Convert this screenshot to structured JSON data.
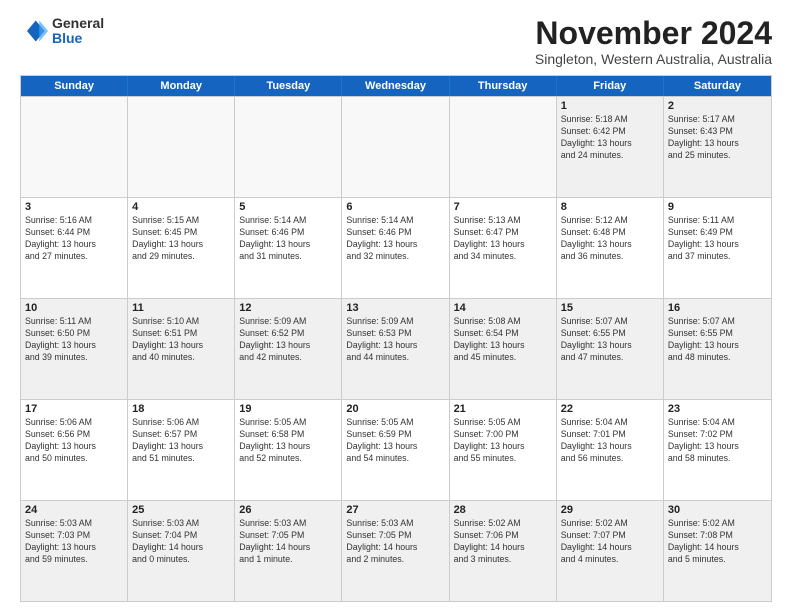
{
  "logo": {
    "general": "General",
    "blue": "Blue"
  },
  "title": "November 2024",
  "subtitle": "Singleton, Western Australia, Australia",
  "header_days": [
    "Sunday",
    "Monday",
    "Tuesday",
    "Wednesday",
    "Thursday",
    "Friday",
    "Saturday"
  ],
  "rows": [
    [
      {
        "day": "",
        "info": "",
        "empty": true
      },
      {
        "day": "",
        "info": "",
        "empty": true
      },
      {
        "day": "",
        "info": "",
        "empty": true
      },
      {
        "day": "",
        "info": "",
        "empty": true
      },
      {
        "day": "",
        "info": "",
        "empty": true
      },
      {
        "day": "1",
        "info": "Sunrise: 5:18 AM\nSunset: 6:42 PM\nDaylight: 13 hours\nand 24 minutes."
      },
      {
        "day": "2",
        "info": "Sunrise: 5:17 AM\nSunset: 6:43 PM\nDaylight: 13 hours\nand 25 minutes."
      }
    ],
    [
      {
        "day": "3",
        "info": "Sunrise: 5:16 AM\nSunset: 6:44 PM\nDaylight: 13 hours\nand 27 minutes."
      },
      {
        "day": "4",
        "info": "Sunrise: 5:15 AM\nSunset: 6:45 PM\nDaylight: 13 hours\nand 29 minutes."
      },
      {
        "day": "5",
        "info": "Sunrise: 5:14 AM\nSunset: 6:46 PM\nDaylight: 13 hours\nand 31 minutes."
      },
      {
        "day": "6",
        "info": "Sunrise: 5:14 AM\nSunset: 6:46 PM\nDaylight: 13 hours\nand 32 minutes."
      },
      {
        "day": "7",
        "info": "Sunrise: 5:13 AM\nSunset: 6:47 PM\nDaylight: 13 hours\nand 34 minutes."
      },
      {
        "day": "8",
        "info": "Sunrise: 5:12 AM\nSunset: 6:48 PM\nDaylight: 13 hours\nand 36 minutes."
      },
      {
        "day": "9",
        "info": "Sunrise: 5:11 AM\nSunset: 6:49 PM\nDaylight: 13 hours\nand 37 minutes."
      }
    ],
    [
      {
        "day": "10",
        "info": "Sunrise: 5:11 AM\nSunset: 6:50 PM\nDaylight: 13 hours\nand 39 minutes."
      },
      {
        "day": "11",
        "info": "Sunrise: 5:10 AM\nSunset: 6:51 PM\nDaylight: 13 hours\nand 40 minutes."
      },
      {
        "day": "12",
        "info": "Sunrise: 5:09 AM\nSunset: 6:52 PM\nDaylight: 13 hours\nand 42 minutes."
      },
      {
        "day": "13",
        "info": "Sunrise: 5:09 AM\nSunset: 6:53 PM\nDaylight: 13 hours\nand 44 minutes."
      },
      {
        "day": "14",
        "info": "Sunrise: 5:08 AM\nSunset: 6:54 PM\nDaylight: 13 hours\nand 45 minutes."
      },
      {
        "day": "15",
        "info": "Sunrise: 5:07 AM\nSunset: 6:55 PM\nDaylight: 13 hours\nand 47 minutes."
      },
      {
        "day": "16",
        "info": "Sunrise: 5:07 AM\nSunset: 6:55 PM\nDaylight: 13 hours\nand 48 minutes."
      }
    ],
    [
      {
        "day": "17",
        "info": "Sunrise: 5:06 AM\nSunset: 6:56 PM\nDaylight: 13 hours\nand 50 minutes."
      },
      {
        "day": "18",
        "info": "Sunrise: 5:06 AM\nSunset: 6:57 PM\nDaylight: 13 hours\nand 51 minutes."
      },
      {
        "day": "19",
        "info": "Sunrise: 5:05 AM\nSunset: 6:58 PM\nDaylight: 13 hours\nand 52 minutes."
      },
      {
        "day": "20",
        "info": "Sunrise: 5:05 AM\nSunset: 6:59 PM\nDaylight: 13 hours\nand 54 minutes."
      },
      {
        "day": "21",
        "info": "Sunrise: 5:05 AM\nSunset: 7:00 PM\nDaylight: 13 hours\nand 55 minutes."
      },
      {
        "day": "22",
        "info": "Sunrise: 5:04 AM\nSunset: 7:01 PM\nDaylight: 13 hours\nand 56 minutes."
      },
      {
        "day": "23",
        "info": "Sunrise: 5:04 AM\nSunset: 7:02 PM\nDaylight: 13 hours\nand 58 minutes."
      }
    ],
    [
      {
        "day": "24",
        "info": "Sunrise: 5:03 AM\nSunset: 7:03 PM\nDaylight: 13 hours\nand 59 minutes."
      },
      {
        "day": "25",
        "info": "Sunrise: 5:03 AM\nSunset: 7:04 PM\nDaylight: 14 hours\nand 0 minutes."
      },
      {
        "day": "26",
        "info": "Sunrise: 5:03 AM\nSunset: 7:05 PM\nDaylight: 14 hours\nand 1 minute."
      },
      {
        "day": "27",
        "info": "Sunrise: 5:03 AM\nSunset: 7:05 PM\nDaylight: 14 hours\nand 2 minutes."
      },
      {
        "day": "28",
        "info": "Sunrise: 5:02 AM\nSunset: 7:06 PM\nDaylight: 14 hours\nand 3 minutes."
      },
      {
        "day": "29",
        "info": "Sunrise: 5:02 AM\nSunset: 7:07 PM\nDaylight: 14 hours\nand 4 minutes."
      },
      {
        "day": "30",
        "info": "Sunrise: 5:02 AM\nSunset: 7:08 PM\nDaylight: 14 hours\nand 5 minutes."
      }
    ]
  ]
}
